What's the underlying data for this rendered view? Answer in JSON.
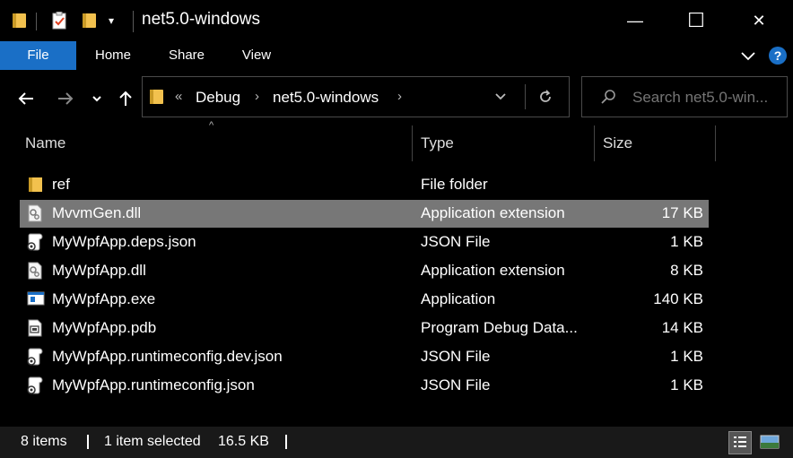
{
  "window": {
    "title": "net5.0-windows",
    "minimize_glyph": "—",
    "maximize_glyph": "☐",
    "close_glyph": "✕"
  },
  "ribbon": {
    "tabs": [
      "File",
      "Home",
      "Share",
      "View"
    ],
    "help_label": "?"
  },
  "address": {
    "overflow": "«",
    "crumbs": [
      "Debug",
      "net5.0-windows"
    ]
  },
  "search": {
    "placeholder": "Search net5.0-win..."
  },
  "columns": {
    "name": "Name",
    "type": "Type",
    "size": "Size"
  },
  "files": [
    {
      "name": "ref",
      "type": "File folder",
      "size": "",
      "icon": "folder-icon",
      "selected": false
    },
    {
      "name": "MvvmGen.dll",
      "type": "Application extension",
      "size": "17 KB",
      "icon": "dll-icon",
      "selected": true
    },
    {
      "name": "MyWpfApp.deps.json",
      "type": "JSON File",
      "size": "1 KB",
      "icon": "json-file-icon",
      "selected": false
    },
    {
      "name": "MyWpfApp.dll",
      "type": "Application extension",
      "size": "8 KB",
      "icon": "dll-icon",
      "selected": false
    },
    {
      "name": "MyWpfApp.exe",
      "type": "Application",
      "size": "140 KB",
      "icon": "exe-icon",
      "selected": false
    },
    {
      "name": "MyWpfApp.pdb",
      "type": "Program Debug Data...",
      "size": "14 KB",
      "icon": "pdb-icon",
      "selected": false
    },
    {
      "name": "MyWpfApp.runtimeconfig.dev.json",
      "type": "JSON File",
      "size": "1 KB",
      "icon": "json-file-icon",
      "selected": false
    },
    {
      "name": "MyWpfApp.runtimeconfig.json",
      "type": "JSON File",
      "size": "1 KB",
      "icon": "json-file-icon",
      "selected": false
    }
  ],
  "status": {
    "item_count": "8 items",
    "selection": "1 item selected",
    "selection_size": "16.5 KB"
  },
  "colors": {
    "accent": "#1a6fc6",
    "selected_row": "#777777",
    "folder": "#f2c14e"
  }
}
